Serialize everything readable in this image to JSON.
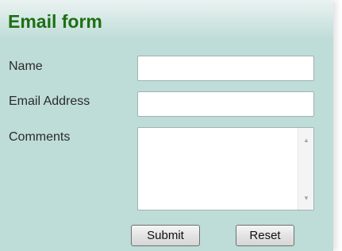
{
  "form": {
    "title": "Email form",
    "name_label": "Name",
    "email_label": "Email Address",
    "comments_label": "Comments",
    "name_value": "",
    "email_value": "",
    "comments_value": "",
    "submit_label": "Submit",
    "reset_label": "Reset"
  },
  "colors": {
    "panel_background": "#bedcd8",
    "title": "#1e6f14"
  },
  "icons": {
    "scroll_up": "scroll-up-arrow-icon",
    "scroll_down": "scroll-down-arrow-icon"
  }
}
